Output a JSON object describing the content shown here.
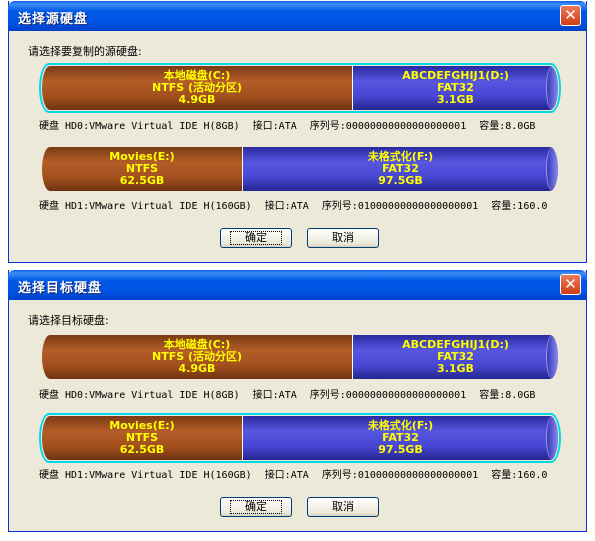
{
  "dialogs": [
    {
      "title": "选择源硬盘",
      "prompt": "请选择要复制的源硬盘:",
      "ok_label": "确定",
      "cancel_label": "取消",
      "selected_disk": 0
    },
    {
      "title": "选择目标硬盘",
      "prompt": "请选择目标硬盘:",
      "ok_label": "确定",
      "cancel_label": "取消",
      "selected_disk": 1
    }
  ],
  "disks": [
    {
      "partitions": [
        {
          "name": "本地磁盘(C:)",
          "fs": "NTFS (活动分区)",
          "size": "4.9GB",
          "type": "ntfs"
        },
        {
          "name": "ABCDEFGHIJ1(D:)",
          "fs": "FAT32",
          "size": "3.1GB",
          "type": "fat"
        }
      ],
      "info": {
        "disk": "硬盘 HD0:VMware Virtual IDE H(8GB)",
        "iface": "接口:ATA",
        "serial": "序列号:00000000000000000001",
        "capacity": "容量:8.0GB"
      }
    },
    {
      "partitions": [
        {
          "name": "Movies(E:)",
          "fs": "NTFS",
          "size": "62.5GB",
          "type": "ntfs"
        },
        {
          "name": "未格式化(F:)",
          "fs": "FAT32",
          "size": "97.5GB",
          "type": "fat"
        }
      ],
      "info": {
        "disk": "硬盘 HD1:VMware Virtual IDE H(160GB)",
        "iface": "接口:ATA",
        "serial": "序列号:01000000000000000001",
        "capacity": "容量:160.0"
      }
    }
  ],
  "colors": {
    "selection_border": "#00d8e8",
    "label_text": "#ffff00",
    "ntfs_fill": "#a14f1e",
    "fat_fill": "#4646d2"
  }
}
